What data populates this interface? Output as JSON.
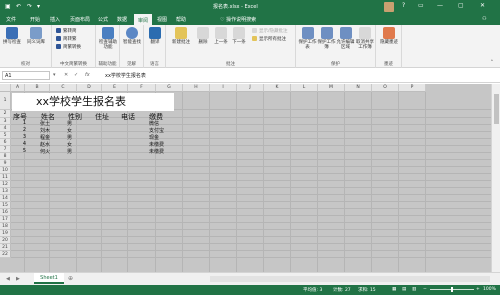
{
  "window": {
    "title": "报名表.xlsx - Excel",
    "controls": [
      "?",
      "▭",
      "—",
      "▢",
      "✕"
    ]
  },
  "tabs": {
    "file": "文件",
    "items": [
      "开始",
      "插入",
      "页面布局",
      "公式",
      "数据",
      "审阅",
      "视图",
      "帮助"
    ],
    "active_index": 5,
    "tell_me": "操作说明搜索",
    "share": "共享"
  },
  "ribbon": {
    "groups": [
      {
        "label": "校对",
        "buttons": [
          "拼写检查",
          "同义词库"
        ]
      },
      {
        "label": "中文简繁转换",
        "buttons": [
          "繁转简",
          "简转繁",
          "简繁转换"
        ]
      },
      {
        "label": "辅助功能",
        "buttons": [
          "检查辅助功能"
        ]
      },
      {
        "label": "见解",
        "buttons": [
          "智能查找"
        ]
      },
      {
        "label": "语言",
        "buttons": [
          "翻译"
        ]
      },
      {
        "label": "批注",
        "buttons": [
          "新建批注",
          "删除",
          "上一条",
          "下一条",
          "显示/隐藏批注",
          "显示所有批注"
        ]
      },
      {
        "label": "保护",
        "buttons": [
          "保护工作表",
          "保护工作簿",
          "允许编辑区域",
          "取消共享工作簿"
        ]
      },
      {
        "label": "墨迹",
        "buttons": [
          "隐藏墨迹"
        ]
      }
    ]
  },
  "formula_bar": {
    "name_box": "A1",
    "fx": "fx",
    "content": "xx学校学生报名表"
  },
  "grid": {
    "columns": [
      "A",
      "B",
      "C",
      "D",
      "E",
      "F",
      "G",
      "H",
      "I",
      "J",
      "K",
      "L",
      "M",
      "N",
      "O",
      "P"
    ],
    "rows": [
      "1",
      "2",
      "3",
      "4",
      "5",
      "6",
      "7",
      "8",
      "9",
      "10",
      "11",
      "12",
      "13",
      "14",
      "15",
      "16",
      "17",
      "18",
      "19",
      "20",
      "21",
      "22"
    ],
    "sheet_title": "xx学校学生报名表",
    "headers": [
      "序号",
      "姓名",
      "性别",
      "住址",
      "电话",
      "缴费"
    ],
    "records": [
      {
        "no": "1",
        "name": "张土",
        "gender": "男",
        "pay": "微信"
      },
      {
        "no": "2",
        "name": "刘木",
        "gender": "女",
        "pay": "支付宝"
      },
      {
        "no": "3",
        "name": "程金",
        "gender": "男",
        "pay": "现金"
      },
      {
        "no": "4",
        "name": "赵水",
        "gender": "女",
        "pay": "未缴费"
      },
      {
        "no": "5",
        "name": "何火",
        "gender": "男",
        "pay": "未缴费"
      }
    ]
  },
  "sheets": {
    "tabs": [
      "Sheet1"
    ],
    "add": "⊕"
  },
  "status": {
    "average": "平均值: 3",
    "count": "计数: 27",
    "sum": "求和: 15",
    "zoom": "100%"
  },
  "colors": {
    "excel_green": "#217346",
    "grid_selection": "#c6c6c6"
  }
}
